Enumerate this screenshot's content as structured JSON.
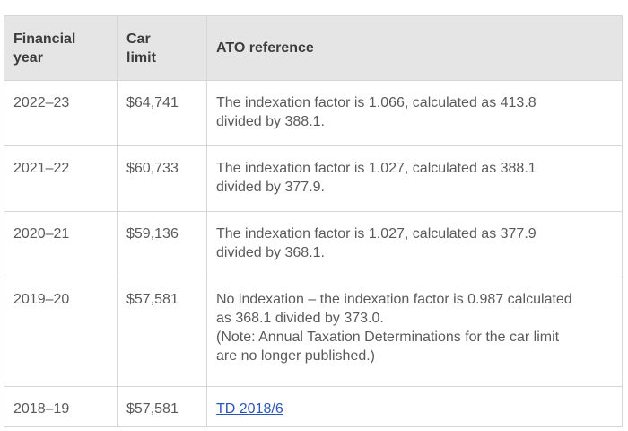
{
  "table": {
    "headers": [
      [
        "Financial",
        "year"
      ],
      [
        "Car",
        "limit"
      ],
      [
        "ATO reference"
      ]
    ],
    "rows": [
      {
        "year": "2022–23",
        "limit": "$64,741",
        "reference": [
          "The indexation factor is 1.066, calculated as 413.8",
          "divided by 388.1."
        ]
      },
      {
        "year": "2021–22",
        "limit": "$60,733",
        "reference": [
          "The indexation factor is 1.027, calculated as 388.1",
          "divided by 377.9."
        ]
      },
      {
        "year": "2020–21",
        "limit": "$59,136",
        "reference": [
          "The indexation factor is 1.027, calculated as 377.9",
          "divided by 368.1."
        ]
      },
      {
        "year": "2019–20",
        "limit": "$57,581",
        "reference": [
          "No indexation – the indexation factor is 0.987 calculated",
          "as 368.1 divided by 373.0.",
          "(Note: Annual Taxation Determinations for the car limit",
          "are no longer published.)"
        ]
      },
      {
        "year": "2018–19",
        "limit": "$57,581",
        "reference_link": "TD 2018/6"
      }
    ]
  }
}
